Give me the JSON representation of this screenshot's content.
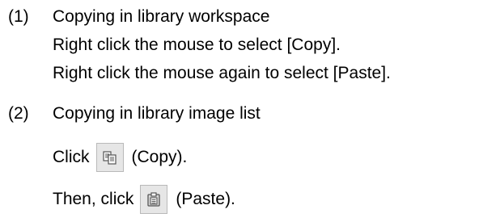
{
  "step1": {
    "number": "(1)",
    "title": "Copying in library workspace",
    "line1": "Right click the mouse to select [Copy].",
    "line2": "Right click the mouse again to select [Paste]."
  },
  "step2": {
    "number": "(2)",
    "title": "Copying in library image list",
    "copy_prefix": "Click",
    "copy_suffix": "(Copy).",
    "copy_icon": "copy-icon",
    "paste_prefix": "Then, click",
    "paste_suffix": "(Paste).",
    "paste_icon": "paste-icon"
  }
}
